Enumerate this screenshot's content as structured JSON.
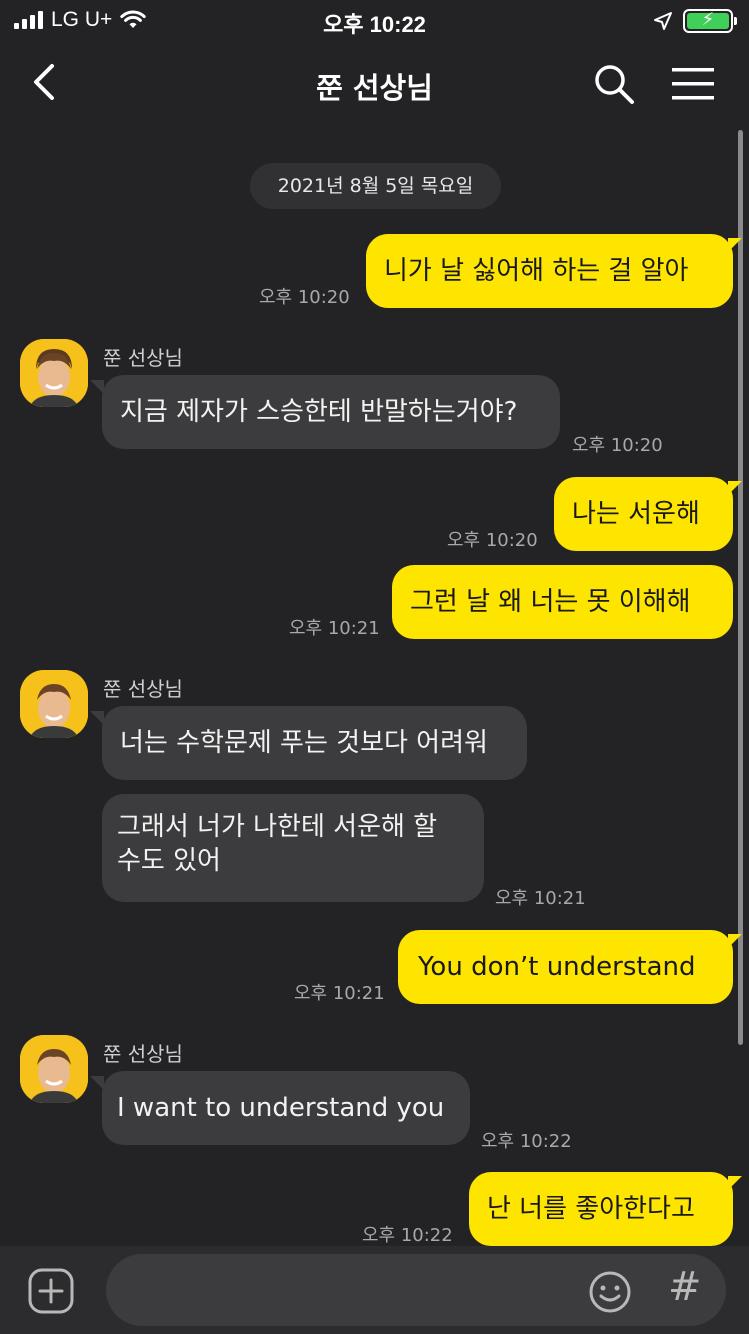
{
  "status_bar": {
    "carrier": "LG U+",
    "time": "오후 10:22"
  },
  "header": {
    "title": "쭌 선상님"
  },
  "date_divider": "2021년 8월 5일 목요일",
  "messages": [
    {
      "from": "me",
      "text": "니가 날 싫어해 하는 걸 알아",
      "time": "오후 10:20"
    },
    {
      "from": "other",
      "sender": "쭌 선상님",
      "text": "지금 제자가 스승한테 반말하는거야?",
      "time": "오후 10:20"
    },
    {
      "from": "me",
      "text": "나는 서운해",
      "time": "오후 10:20"
    },
    {
      "from": "me",
      "text": "그런 날 왜 너는 못 이해해",
      "time": "오후 10:21"
    },
    {
      "from": "other",
      "sender": "쭌 선상님",
      "text": "너는 수학문제 푸는 것보다 어려워"
    },
    {
      "from": "other",
      "text_line1": "그래서 너가 나한테 서운해 할",
      "text_line2": "수도 있어",
      "time": "오후 10:21"
    },
    {
      "from": "me",
      "text": "You don’t understand",
      "time": "오후 10:21"
    },
    {
      "from": "other",
      "sender": "쭌 선상님",
      "text": "I want to understand you",
      "time": "오후 10:22"
    },
    {
      "from": "me",
      "text": "난 너를 좋아한다고",
      "time": "오후 10:22"
    }
  ],
  "input": {
    "placeholder": ""
  },
  "colors": {
    "background": "#232325",
    "my_bubble": "#fee500",
    "other_bubble": "#3c3c3e",
    "battery": "#3fd05a"
  },
  "icons": [
    "back-icon",
    "search-icon",
    "menu-icon",
    "plus-icon",
    "emoji-icon",
    "hash-icon",
    "location-arrow-icon",
    "wifi-icon",
    "cellular-signal-icon",
    "battery-charging-icon"
  ]
}
